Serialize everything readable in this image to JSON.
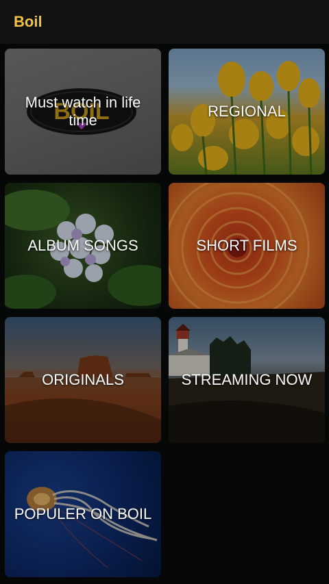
{
  "app_bar": {
    "title": "Boil",
    "title_color": "#f5c242",
    "background": "#121212"
  },
  "categories": [
    {
      "label": "Must watch in life time",
      "image": "boil-logo"
    },
    {
      "label": "REGIONAL",
      "image": "tulips"
    },
    {
      "label": "ALBUM SONGS",
      "image": "hydrangea"
    },
    {
      "label": "SHORT FILMS",
      "image": "chrysanthemum"
    },
    {
      "label": "ORIGINALS",
      "image": "desert"
    },
    {
      "label": "STREAMING NOW",
      "image": "lighthouse"
    },
    {
      "label": "POPULER ON BOIL",
      "image": "jellyfish"
    }
  ],
  "logo": {
    "text": "BOIL"
  }
}
